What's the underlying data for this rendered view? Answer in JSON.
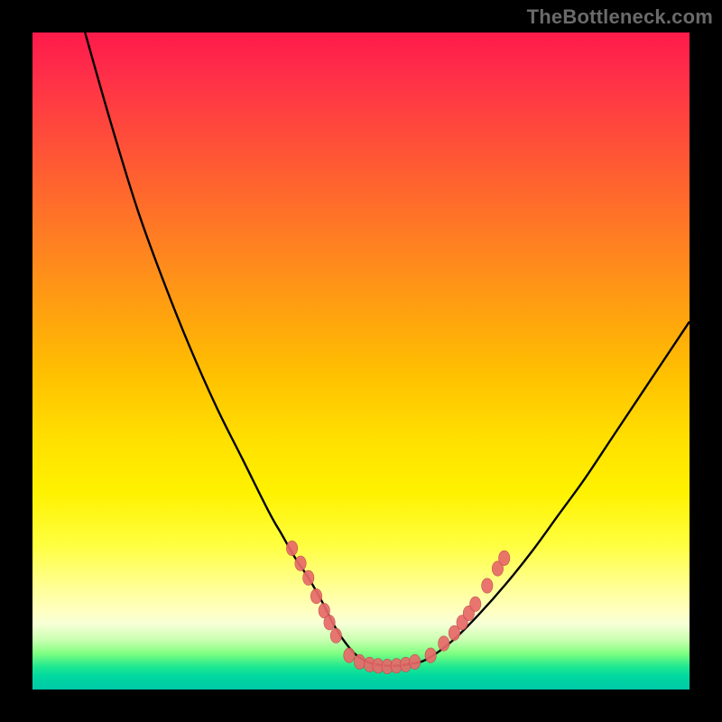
{
  "attribution": "TheBottleneck.com",
  "colors": {
    "curve": "#000000",
    "dot_fill": "#e86a6a",
    "dot_stroke": "#c04848"
  },
  "chart_data": {
    "type": "line",
    "title": "",
    "xlabel": "",
    "ylabel": "",
    "xlim": [
      0,
      100
    ],
    "ylim": [
      0,
      100
    ],
    "grid": false,
    "legend": false,
    "series": [
      {
        "name": "curve",
        "x": [
          8,
          12,
          16,
          20,
          24,
          28,
          32,
          36,
          38,
          40,
          42,
          44,
          45.5,
          47,
          49,
          51,
          53,
          55,
          57,
          60,
          64,
          68,
          72,
          76,
          80,
          84,
          88,
          92,
          96,
          100
        ],
        "y": [
          100,
          86,
          73,
          62,
          52,
          43,
          35,
          27,
          23.5,
          20,
          17,
          13.5,
          10.5,
          8,
          5.5,
          4.2,
          3.7,
          3.6,
          3.8,
          4.6,
          7.5,
          11.5,
          16,
          21,
          26.5,
          32,
          38,
          44,
          50,
          56
        ]
      }
    ],
    "dots": [
      {
        "x": 39.5,
        "y": 21.5
      },
      {
        "x": 40.8,
        "y": 19.2
      },
      {
        "x": 42.0,
        "y": 17.0
      },
      {
        "x": 43.2,
        "y": 14.2
      },
      {
        "x": 44.4,
        "y": 12.0
      },
      {
        "x": 45.2,
        "y": 10.2
      },
      {
        "x": 46.2,
        "y": 8.2
      },
      {
        "x": 48.2,
        "y": 5.2
      },
      {
        "x": 49.8,
        "y": 4.2
      },
      {
        "x": 51.3,
        "y": 3.8
      },
      {
        "x": 52.6,
        "y": 3.6
      },
      {
        "x": 54.0,
        "y": 3.5
      },
      {
        "x": 55.4,
        "y": 3.6
      },
      {
        "x": 56.8,
        "y": 3.8
      },
      {
        "x": 58.2,
        "y": 4.2
      },
      {
        "x": 60.6,
        "y": 5.2
      },
      {
        "x": 62.6,
        "y": 7.0
      },
      {
        "x": 64.2,
        "y": 8.6
      },
      {
        "x": 65.4,
        "y": 10.2
      },
      {
        "x": 66.4,
        "y": 11.6
      },
      {
        "x": 67.4,
        "y": 13.0
      },
      {
        "x": 69.2,
        "y": 15.8
      },
      {
        "x": 70.8,
        "y": 18.4
      },
      {
        "x": 71.8,
        "y": 20.0
      }
    ]
  }
}
